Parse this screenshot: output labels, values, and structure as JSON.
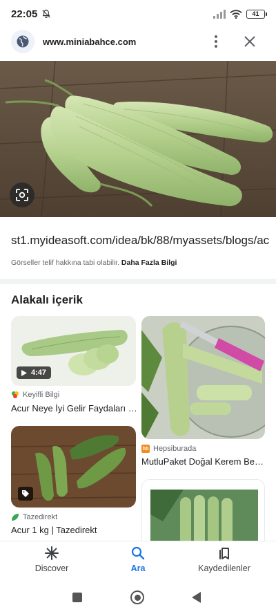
{
  "status_bar": {
    "time": "22:05",
    "battery": "41",
    "icons": [
      "muted-bell-icon",
      "signal-icon",
      "wifi-icon",
      "battery-icon"
    ]
  },
  "header": {
    "site": "www.miniabahce.com",
    "icons": [
      "globe-icon",
      "more-vert-icon",
      "close-icon"
    ]
  },
  "image": {
    "source_url": "st1.myideasoft.com/idea/bk/88/myassets/blogs/ac",
    "copyright_text": "Görseller telif hakkına tabi olabilir.",
    "more_info": "Daha Fazla Bilgi"
  },
  "related": {
    "title": "Alakalı içerik",
    "cards": [
      {
        "source": "Keyifli Bilgi",
        "title": "Acur Neye İyi Gelir Faydaları …",
        "duration": "4:47"
      },
      {
        "source": "Hepsiburada",
        "title": "MutluPaket Doğal Kerem Be…"
      },
      {
        "source": "Tazedirekt",
        "title": "Acur 1 kg | Tazedirekt"
      }
    ]
  },
  "bottom_nav": {
    "items": [
      {
        "label": "Discover",
        "icon": "asterisk-icon"
      },
      {
        "label": "Ara",
        "icon": "search-icon"
      },
      {
        "label": "Kaydedilenler",
        "icon": "bookmarks-icon"
      }
    ],
    "active": "Ara"
  },
  "colors": {
    "accent": "#1a73e8",
    "hb_orange": "#f28b20",
    "leaf_green": "#34a853"
  }
}
